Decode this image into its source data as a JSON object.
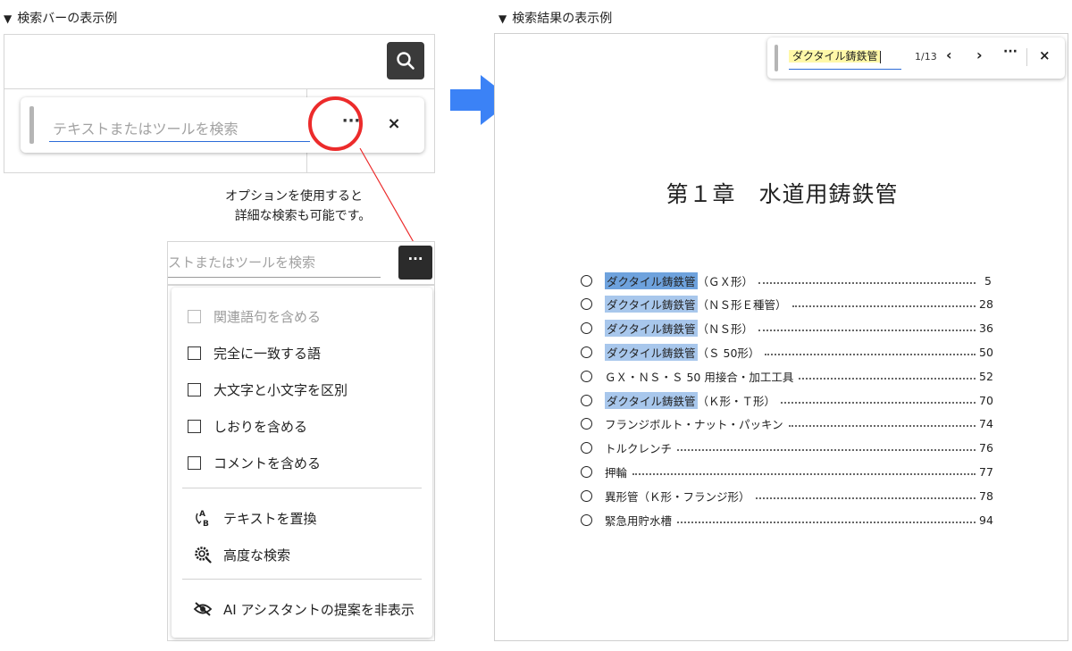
{
  "captions": {
    "left": "検索バーの表示例",
    "right": "検索結果の表示例",
    "marker": "▼"
  },
  "left_panel": {
    "search_button_icon": "search-icon",
    "search_bar": {
      "placeholder": "テキストまたはツールを検索",
      "more_label": "···",
      "close_label": "×"
    },
    "note_lines": [
      "オプションを使用すると",
      "詳細な検索も可能です。"
    ],
    "dropdown": {
      "input_text": "ストまたはツールを検索",
      "more_label": "···",
      "options": [
        {
          "label": "関連語句を含める",
          "checked": false,
          "disabled": true
        },
        {
          "label": "完全に一致する語",
          "checked": false,
          "disabled": false
        },
        {
          "label": "大文字と小文字を区別",
          "checked": false,
          "disabled": false
        },
        {
          "label": "しおりを含める",
          "checked": false,
          "disabled": false
        },
        {
          "label": "コメントを含める",
          "checked": false,
          "disabled": false
        }
      ],
      "actions": [
        {
          "label": "テキストを置換",
          "icon": "replace-text-icon"
        },
        {
          "label": "高度な検索",
          "icon": "advanced-search-icon"
        },
        {
          "label": "AI アシスタントの提案を非表示",
          "icon": "eye-off-icon"
        }
      ]
    },
    "highlight_color": "#ec2b2b"
  },
  "arrow_color": "#3b82f6",
  "right_panel": {
    "find_bar": {
      "query": "ダクタイル鋳鉄管",
      "count": "1/13",
      "prev_label": "‹",
      "next_label": "›",
      "more_label": "···",
      "close_label": "×"
    },
    "chapter_title": "第１章　水道用鋳鉄管",
    "toc": [
      {
        "hl": "ダクタイル鋳鉄管",
        "current": true,
        "rest": "（ＧＸ形）",
        "page": "5"
      },
      {
        "hl": "ダクタイル鋳鉄管",
        "current": false,
        "rest": "（ＮＳ形Ｅ種管）",
        "page": "28"
      },
      {
        "hl": "ダクタイル鋳鉄管",
        "current": false,
        "rest": "（ＮＳ形）",
        "page": "36"
      },
      {
        "hl": "ダクタイル鋳鉄管",
        "current": false,
        "rest": "（Ｓ 50形）",
        "page": "50"
      },
      {
        "hl": "",
        "current": false,
        "rest": "ＧＸ・ＮＳ・Ｓ 50 用接合・加工工具",
        "page": "52"
      },
      {
        "hl": "ダクタイル鋳鉄管",
        "current": false,
        "rest": "（Ｋ形・Ｔ形）",
        "page": "70"
      },
      {
        "hl": "",
        "current": false,
        "rest": "フランジボルト・ナット・パッキン",
        "page": "74"
      },
      {
        "hl": "",
        "current": false,
        "rest": "トルクレンチ",
        "page": "76"
      },
      {
        "hl": "",
        "current": false,
        "rest": "押輪",
        "page": "77"
      },
      {
        "hl": "",
        "current": false,
        "rest": "異形管（Ｋ形・フランジ形）",
        "page": "78"
      },
      {
        "hl": "",
        "current": false,
        "rest": "緊急用貯水槽",
        "page": "94"
      }
    ],
    "highlight_color": "#a8c7ec",
    "current_highlight_color": "#6ea2dd"
  }
}
